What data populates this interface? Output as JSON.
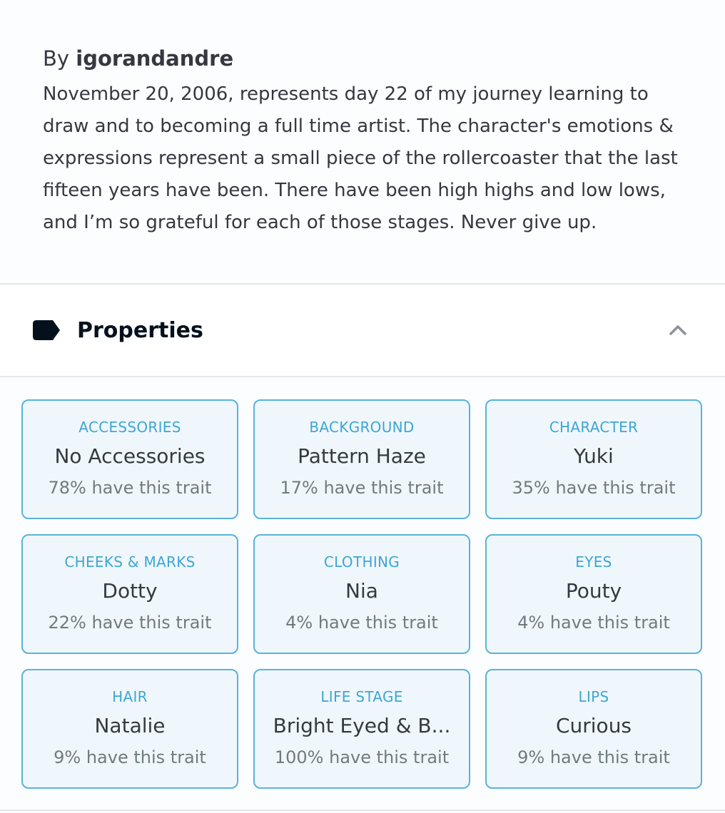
{
  "description": {
    "by_prefix": "By",
    "author": "igorandandre",
    "text": "November 20, 2006, represents day 22 of my journey learning to draw and to becoming a full time artist. The character's emotions & expressions represent a small piece of the rollercoaster that the last fifteen years have been. There have been high highs and low lows, and I’m so grateful for each of those stages. Never give up."
  },
  "properties": {
    "title": "Properties",
    "icon": "tag-icon",
    "toggle_icon": "chevron-up-icon",
    "items": [
      {
        "type": "ACCESSORIES",
        "value": "No Accessories",
        "rarity": "78% have this trait"
      },
      {
        "type": "BACKGROUND",
        "value": "Pattern Haze",
        "rarity": "17% have this trait"
      },
      {
        "type": "CHARACTER",
        "value": "Yuki",
        "rarity": "35% have this trait"
      },
      {
        "type": "CHEEKS & MARKS",
        "value": "Dotty",
        "rarity": "22% have this trait"
      },
      {
        "type": "CLOTHING",
        "value": "Nia",
        "rarity": "4% have this trait"
      },
      {
        "type": "EYES",
        "value": "Pouty",
        "rarity": "4% have this trait"
      },
      {
        "type": "HAIR",
        "value": "Natalie",
        "rarity": "9% have this trait"
      },
      {
        "type": "LIFE STAGE",
        "value": "Bright Eyed & B...",
        "rarity": "100% have this trait"
      },
      {
        "type": "LIPS",
        "value": "Curious",
        "rarity": "9% have this trait"
      }
    ]
  },
  "colors": {
    "accent": "#3ea6d3",
    "card_border": "#59b3d9",
    "card_bg": "#eff7fc"
  }
}
